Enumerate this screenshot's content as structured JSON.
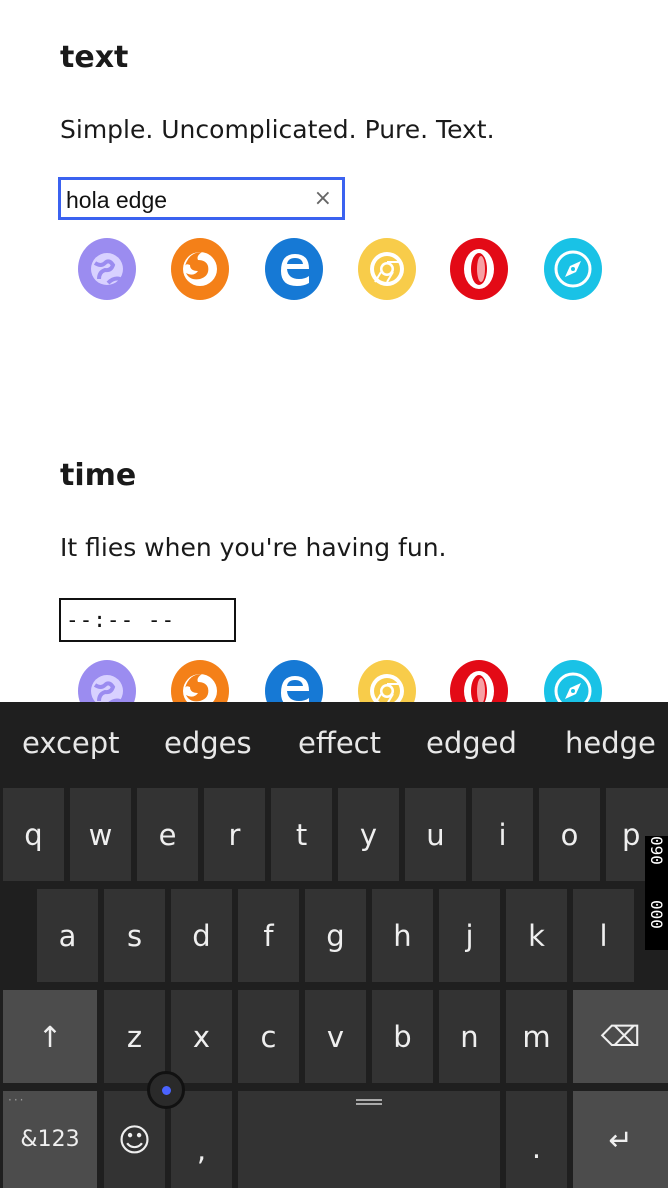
{
  "sections": [
    {
      "heading": "text",
      "description": "Simple. Uncomplicated. Pure. Text.",
      "input_value": "hola edge",
      "clear_glyph": "×"
    },
    {
      "heading": "time",
      "description": "It flies when you're having fun.",
      "input_value": "--:-- --"
    }
  ],
  "browser_icons": [
    {
      "name": "samsung-internet",
      "color": "#9b8cf0"
    },
    {
      "name": "firefox",
      "color": "#f48018"
    },
    {
      "name": "edge",
      "color": "#1679d5"
    },
    {
      "name": "chrome",
      "color": "#f8cc4a"
    },
    {
      "name": "opera",
      "color": "#e30a16"
    },
    {
      "name": "safari",
      "color": "#19c2e6"
    }
  ],
  "keyboard": {
    "suggestions": [
      "except",
      "edges",
      "effect",
      "edged",
      "hedge"
    ],
    "row1": [
      "q",
      "w",
      "e",
      "r",
      "t",
      "y",
      "u",
      "i",
      "o",
      "p"
    ],
    "row2": [
      "a",
      "s",
      "d",
      "f",
      "g",
      "h",
      "j",
      "k",
      "l"
    ],
    "row3": [
      "z",
      "x",
      "c",
      "v",
      "b",
      "n",
      "m"
    ],
    "shift_glyph": "↑",
    "backspace_glyph": "⌫",
    "symbols_label": "&123",
    "emoji_glyph": "☺",
    "comma": ",",
    "period": ".",
    "enter_glyph": "↵",
    "side_tab_top": "090",
    "side_tab_bottom": "000"
  }
}
